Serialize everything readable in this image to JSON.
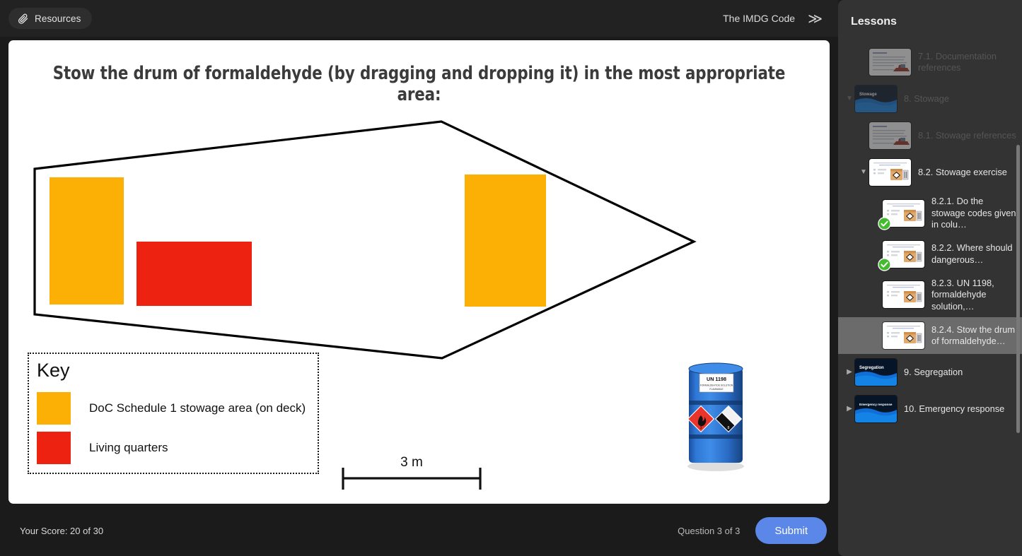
{
  "topbar": {
    "resources_label": "Resources",
    "resources_icon": "paperclip-icon",
    "course_title": "The IMDG Code",
    "expand_icon": "chevron-double-right-icon"
  },
  "slide": {
    "title": "Stow the drum of formaldehyde (by dragging and dropping it) in the most appropriate area:",
    "key": {
      "title": "Key",
      "items": [
        {
          "color": "#FCB005",
          "label": "DoC Schedule 1 stowage area (on deck)"
        },
        {
          "color": "#EE2211",
          "label": "Living quarters"
        }
      ]
    },
    "scale": {
      "label": "3 m"
    },
    "drum": {
      "name": "formaldehyde-drum",
      "un_number": "UN 1198",
      "substance": "FORMALDEHYDE SOLUTION",
      "hazard": "FLAMMABLE",
      "body_color": "#1f63c8"
    },
    "ship": {
      "name": "ship-deck-outline",
      "outline_color": "#000000",
      "zones": [
        {
          "name": "stowage-area-aft",
          "color": "#FCB005"
        },
        {
          "name": "living-quarters",
          "color": "#EE2211"
        },
        {
          "name": "stowage-area-forward",
          "color": "#FCB005"
        }
      ]
    }
  },
  "lessons": {
    "header": "Lessons",
    "items": [
      {
        "label": "7.1. Documentation references",
        "indent": 2,
        "caret": "none",
        "state": "dim",
        "thumb": "doc",
        "done": false
      },
      {
        "label": "8. Stowage",
        "indent": 1,
        "caret": "down",
        "state": "dim",
        "thumb": "stowage-title",
        "done": false
      },
      {
        "label": "8.1. Stowage references",
        "indent": 2,
        "caret": "none",
        "state": "dim",
        "thumb": "doc",
        "done": false
      },
      {
        "label": "8.2. Stowage exercise",
        "indent": 2,
        "caret": "down",
        "state": "normal",
        "thumb": "exercise",
        "done": false
      },
      {
        "label": "8.2.1. Do the stowage codes given in colu…",
        "indent": 3,
        "caret": "none",
        "state": "normal",
        "thumb": "exercise",
        "done": true
      },
      {
        "label": "8.2.2. Where should dangerous…",
        "indent": 3,
        "caret": "none",
        "state": "normal",
        "thumb": "exercise",
        "done": true
      },
      {
        "label": "8.2.3. UN 1198, formaldehyde solution,…",
        "indent": 3,
        "caret": "none",
        "state": "normal",
        "thumb": "exercise",
        "done": false
      },
      {
        "label": "8.2.4. Stow the drum of formaldehyde…",
        "indent": 3,
        "caret": "none",
        "state": "active",
        "thumb": "exercise",
        "done": false
      },
      {
        "label": "9. Segregation",
        "indent": 1,
        "caret": "right",
        "state": "normal",
        "thumb": "segregation-title",
        "done": false
      },
      {
        "label": "10. Emergency response",
        "indent": 1,
        "caret": "right",
        "state": "normal",
        "thumb": "emergency-title",
        "done": false
      }
    ],
    "thumb_titles": {
      "stowage-title": "Stowage",
      "segregation-title": "Segregation",
      "emergency-title": "Emergency response"
    }
  },
  "footer": {
    "score": "Your Score: 20 of 30",
    "question_counter": "Question 3 of 3",
    "submit_label": "Submit",
    "accent_color": "#5b87e8"
  }
}
